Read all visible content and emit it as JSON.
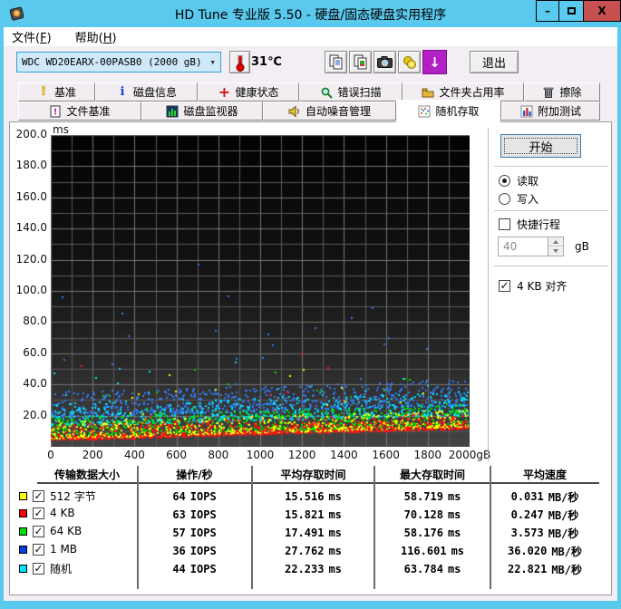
{
  "window": {
    "title": "HD Tune 专业版 5.50 - 硬盘/固态硬盘实用程序",
    "controls": {
      "minimize": "–",
      "close": "X"
    }
  },
  "menu": {
    "file": {
      "pre": "文件(",
      "key": "F",
      "post": ")"
    },
    "help": {
      "pre": "帮助(",
      "key": "H",
      "post": ")"
    }
  },
  "toolbar": {
    "drive_select": "WDC WD20EARX-00PASB0 (2000 gB)",
    "temperature": "31℃",
    "exit_label": "退出",
    "download_glyph": "↓"
  },
  "tabs": {
    "row1": [
      {
        "label": "基准",
        "icon": "benchmark-icon"
      },
      {
        "label": "磁盘信息",
        "icon": "disk-info-icon"
      },
      {
        "label": "健康状态",
        "icon": "health-icon"
      },
      {
        "label": "错误扫描",
        "icon": "error-scan-icon"
      },
      {
        "label": "文件夹占用率",
        "icon": "folder-usage-icon"
      },
      {
        "label": "擦除",
        "icon": "erase-icon"
      }
    ],
    "row2": [
      {
        "label": "文件基准",
        "icon": "file-benchmark-icon"
      },
      {
        "label": "磁盘监视器",
        "icon": "disk-monitor-icon"
      },
      {
        "label": "自动噪音管理",
        "icon": "aam-icon"
      },
      {
        "label": "随机存取",
        "icon": "random-access-icon"
      },
      {
        "label": "附加测试",
        "icon": "extra-tests-icon"
      }
    ],
    "active": "随机存取"
  },
  "controls": {
    "start_label": "开始",
    "read_label": "读取",
    "write_label": "写入",
    "short_stroke_label": "快捷行程",
    "short_stroke_value": "40",
    "short_stroke_unit": "gB",
    "align_label": "4 KB 对齐"
  },
  "table": {
    "headers": [
      "传输数据大小",
      "操作/秒",
      "平均存取时间",
      "最大存取时间",
      "平均速度"
    ],
    "rows": [
      {
        "swatch": "#ffff00",
        "checked": "✓",
        "label": "512 字节",
        "iops": "64",
        "iops_unit": "IOPS",
        "avg": "15.516",
        "avg_unit": "ms",
        "max": "58.719",
        "max_unit": "ms",
        "speed": "0.031",
        "speed_unit": "MB/秒"
      },
      {
        "swatch": "#ff0000",
        "checked": "✓",
        "label": "4 KB",
        "iops": "63",
        "iops_unit": "IOPS",
        "avg": "15.821",
        "avg_unit": "ms",
        "max": "70.128",
        "max_unit": "ms",
        "speed": "0.247",
        "speed_unit": "MB/秒"
      },
      {
        "swatch": "#00e000",
        "checked": "✓",
        "label": "64 KB",
        "iops": "57",
        "iops_unit": "IOPS",
        "avg": "17.491",
        "avg_unit": "ms",
        "max": "58.176",
        "max_unit": "ms",
        "speed": "3.573",
        "speed_unit": "MB/秒"
      },
      {
        "swatch": "#0040dd",
        "checked": "✓",
        "label": "1 MB",
        "iops": "36",
        "iops_unit": "IOPS",
        "avg": "27.762",
        "avg_unit": "ms",
        "max": "116.601",
        "max_unit": "ms",
        "speed": "36.020",
        "speed_unit": "MB/秒"
      },
      {
        "swatch": "#00e5ff",
        "checked": "✓",
        "label": "随机",
        "iops": "44",
        "iops_unit": "IOPS",
        "avg": "22.233",
        "avg_unit": "ms",
        "max": "63.784",
        "max_unit": "ms",
        "speed": "22.821",
        "speed_unit": "MB/秒"
      }
    ]
  },
  "chart_data": {
    "type": "scatter",
    "title": "",
    "xlabel": "",
    "ylabel": "ms",
    "xlim": [
      0,
      2000
    ],
    "ylim": [
      0,
      200
    ],
    "x_ticks": [
      0,
      200,
      400,
      600,
      800,
      1000,
      1200,
      1400,
      1600,
      1800,
      2000
    ],
    "x_tick_last_suffix": "gB",
    "y_ticks": [
      20,
      40,
      60,
      80,
      100,
      120,
      140,
      160,
      180,
      200
    ],
    "grid": {
      "x_minor_step": 100,
      "y_minor_step": 10,
      "on": true
    },
    "seed": 1987,
    "envelope_ms": {
      "y_at_0": 5,
      "y_at_max": 12.5
    },
    "series": [
      {
        "name": "512 字节",
        "color": "#ffff00",
        "count": 760,
        "offset": 0,
        "spread": 11,
        "skew": 2.2,
        "outlier_rate": 0.02,
        "avg_ms": 15.516,
        "max_ms": 58.719
      },
      {
        "name": "4 KB",
        "color": "#ff1414",
        "count": 760,
        "offset": -1,
        "spread": 10,
        "skew": 2.4,
        "outlier_rate": 0.015,
        "avg_ms": 15.821,
        "max_ms": 70.128
      },
      {
        "name": "64 KB",
        "color": "#00dd00",
        "count": 760,
        "offset": 1.5,
        "spread": 13,
        "skew": 2.0,
        "outlier_rate": 0.02,
        "avg_ms": 17.491,
        "max_ms": 58.176
      },
      {
        "name": "1 MB",
        "color": "#2e7dff",
        "count": 700,
        "offset": 14,
        "spread": 16,
        "skew": 1.6,
        "outlier_rate": 0.03,
        "avg_ms": 27.762,
        "max_ms": 116.601,
        "peak": [
          706,
          116.6
        ]
      },
      {
        "name": "随机",
        "color": "#00e0ff",
        "count": 700,
        "offset": 8,
        "spread": 15,
        "skew": 1.8,
        "outlier_rate": 0.02,
        "avg_ms": 22.233,
        "max_ms": 63.784
      }
    ],
    "draw_order": [
      3,
      4,
      2,
      0,
      1
    ]
  }
}
